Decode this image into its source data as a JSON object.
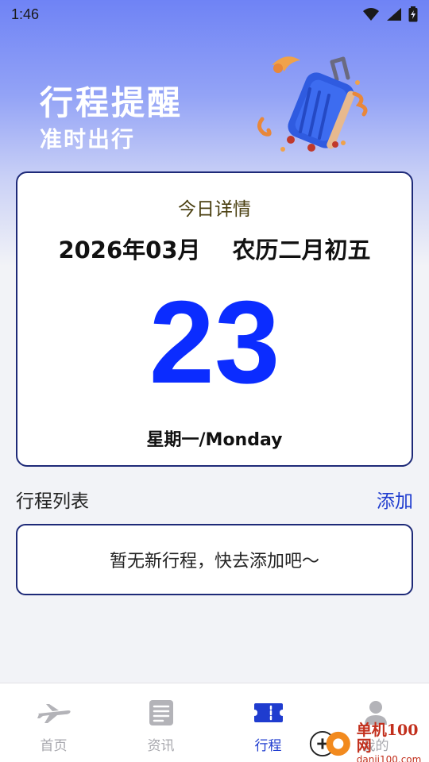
{
  "status_bar": {
    "time": "1:46"
  },
  "hero": {
    "title": "行程提醒",
    "subtitle": "准时出行"
  },
  "today": {
    "heading": "今日详情",
    "year_month": "2026年03月",
    "lunar": "农历二月初五",
    "day": "23",
    "weekday": "星期一/Monday"
  },
  "trips": {
    "title": "行程列表",
    "add_label": "添加",
    "empty_message": "暂无新行程，快去添加吧～"
  },
  "nav": {
    "items": [
      {
        "label": "首页",
        "icon": "airplane-icon"
      },
      {
        "label": "资讯",
        "icon": "news-icon"
      },
      {
        "label": "行程",
        "icon": "ticket-icon",
        "active": true
      },
      {
        "label": "我的",
        "icon": "person-icon"
      }
    ]
  },
  "watermark": {
    "main": "单机100网",
    "sub": "danji100.com"
  },
  "colors": {
    "accent": "#1f3ccf",
    "day_number": "#0b2cff",
    "card_border": "#1e2a78"
  }
}
